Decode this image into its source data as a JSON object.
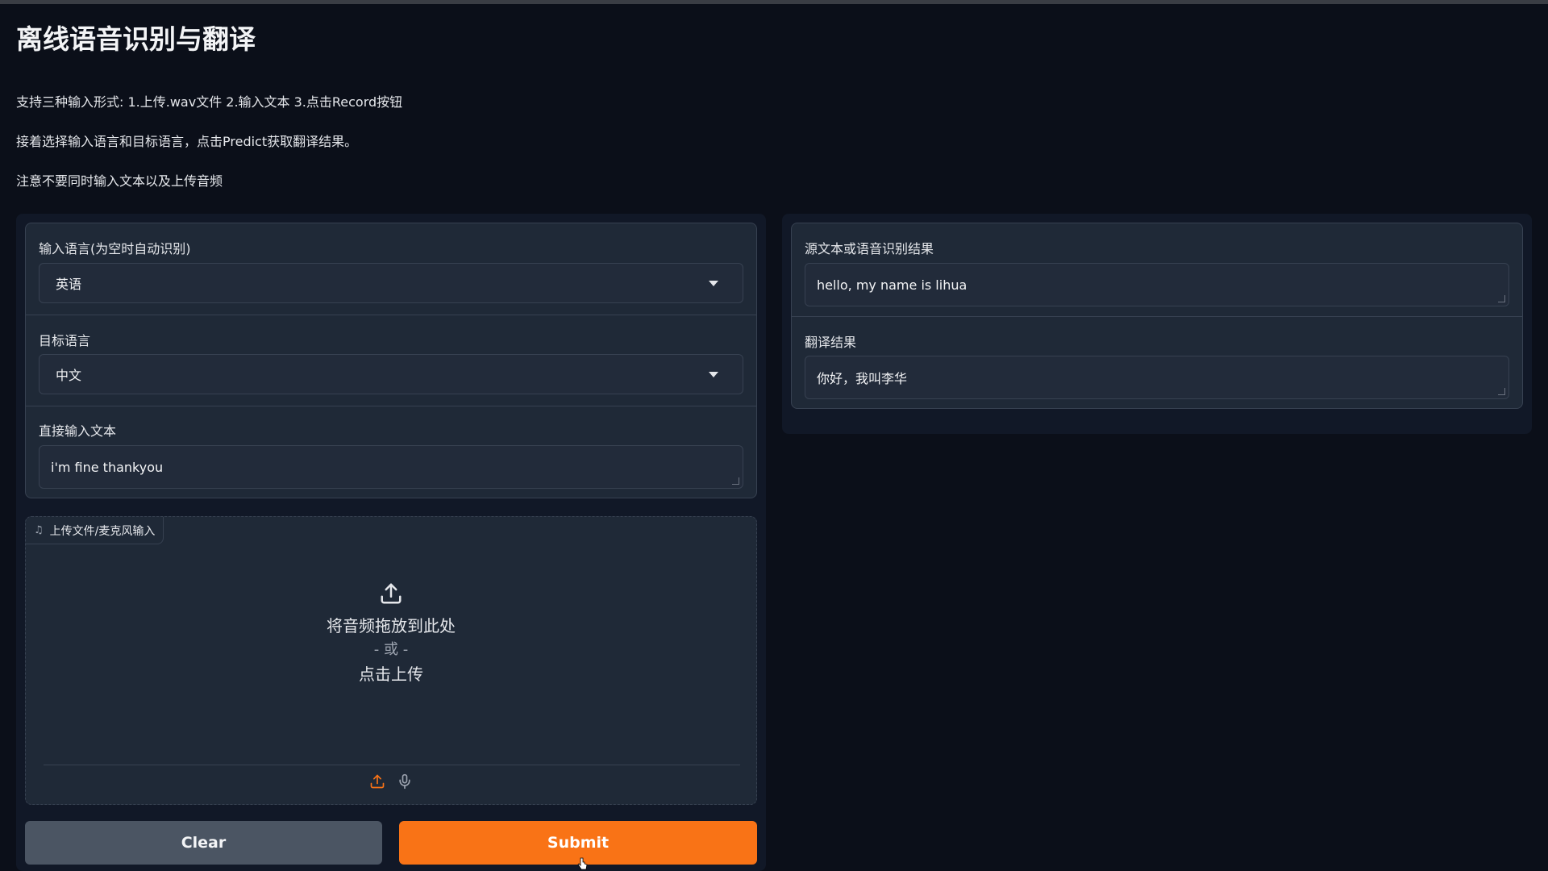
{
  "page": {
    "title": "离线语音识别与翻译",
    "descriptions": [
      "支持三种输入形式: 1.上传.wav文件 2.输入文本 3.点击Record按钮",
      "接着选择输入语言和目标语言，点击Predict获取翻译结果。",
      "注意不要同时输入文本以及上传音频"
    ]
  },
  "inputs": {
    "input_language": {
      "label": "输入语言(为空时自动识别)",
      "value": "英语"
    },
    "target_language": {
      "label": "目标语言",
      "value": "中文"
    },
    "direct_text": {
      "label": "直接输入文本",
      "value": "i'm fine thankyou"
    }
  },
  "upload": {
    "label": "上传文件/麦克风输入",
    "drop_text": "将音频拖放到此处",
    "or_text": "- 或 -",
    "click_text": "点击上传"
  },
  "outputs": {
    "source": {
      "label": "源文本或语音识别结果",
      "value": "hello, my name is lihua"
    },
    "translation": {
      "label": "翻译结果",
      "value": "你好，我叫李华"
    }
  },
  "buttons": {
    "clear": "Clear",
    "submit": "Submit"
  },
  "colors": {
    "background": "#0b0f19",
    "panel": "#1f2937",
    "accent": "#f97316",
    "secondary_button": "#4b5563"
  },
  "icons": [
    "music-note-icon",
    "upload-icon",
    "microphone-icon",
    "chevron-down-icon"
  ]
}
